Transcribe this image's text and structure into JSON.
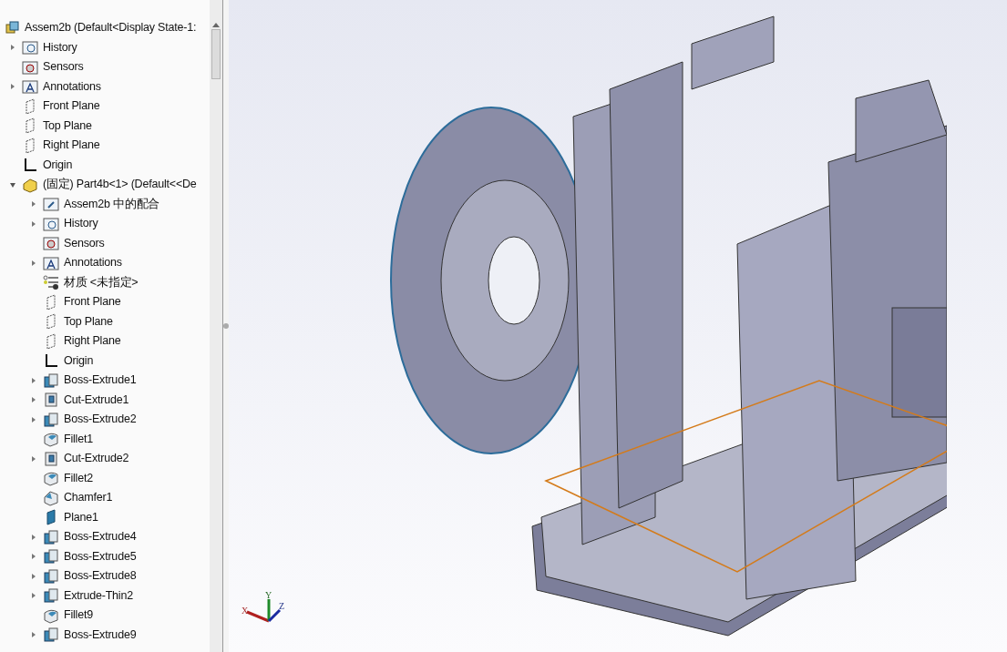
{
  "feature_tree": {
    "root": {
      "label": "Assem2b  (Default<Display State-1:",
      "kind": "assembly",
      "children": [
        {
          "label": "History",
          "kind": "history",
          "expandable": true,
          "expanded": false
        },
        {
          "label": "Sensors",
          "kind": "sensors",
          "expandable": false
        },
        {
          "label": "Annotations",
          "kind": "annotations",
          "expandable": true,
          "expanded": false
        },
        {
          "label": "Front Plane",
          "kind": "plane",
          "expandable": false
        },
        {
          "label": "Top Plane",
          "kind": "plane",
          "expandable": false
        },
        {
          "label": "Right Plane",
          "kind": "plane",
          "expandable": false
        },
        {
          "label": "Origin",
          "kind": "origin",
          "expandable": false
        },
        {
          "label": "(固定) Part4b<1> (Default<<De",
          "kind": "part",
          "expandable": true,
          "expanded": true,
          "children": [
            {
              "label": "Assem2b 中的配合",
              "kind": "mates",
              "expandable": true,
              "expanded": false
            },
            {
              "label": "History",
              "kind": "history",
              "expandable": true,
              "expanded": false
            },
            {
              "label": "Sensors",
              "kind": "sensors",
              "expandable": false
            },
            {
              "label": "Annotations",
              "kind": "annotations",
              "expandable": true,
              "expanded": false
            },
            {
              "label": "材质 <未指定>",
              "kind": "material",
              "expandable": false
            },
            {
              "label": "Front Plane",
              "kind": "plane",
              "expandable": false
            },
            {
              "label": "Top Plane",
              "kind": "plane",
              "expandable": false
            },
            {
              "label": "Right Plane",
              "kind": "plane",
              "expandable": false
            },
            {
              "label": "Origin",
              "kind": "origin",
              "expandable": false
            },
            {
              "label": "Boss-Extrude1",
              "kind": "boss",
              "expandable": true,
              "expanded": false
            },
            {
              "label": "Cut-Extrude1",
              "kind": "cut",
              "expandable": true,
              "expanded": false
            },
            {
              "label": "Boss-Extrude2",
              "kind": "boss",
              "expandable": true,
              "expanded": false
            },
            {
              "label": "Fillet1",
              "kind": "fillet",
              "expandable": false
            },
            {
              "label": "Cut-Extrude2",
              "kind": "cut",
              "expandable": true,
              "expanded": false
            },
            {
              "label": "Fillet2",
              "kind": "fillet",
              "expandable": false
            },
            {
              "label": "Chamfer1",
              "kind": "chamfer",
              "expandable": false
            },
            {
              "label": "Plane1",
              "kind": "refplane",
              "expandable": false
            },
            {
              "label": "Boss-Extrude4",
              "kind": "boss",
              "expandable": true,
              "expanded": false
            },
            {
              "label": "Boss-Extrude5",
              "kind": "boss",
              "expandable": true,
              "expanded": false
            },
            {
              "label": "Boss-Extrude8",
              "kind": "boss",
              "expandable": true,
              "expanded": false
            },
            {
              "label": "Extrude-Thin2",
              "kind": "boss",
              "expandable": true,
              "expanded": false
            },
            {
              "label": "Fillet9",
              "kind": "fillet",
              "expandable": false
            },
            {
              "label": "Boss-Extrude9",
              "kind": "boss",
              "expandable": true,
              "expanded": false
            }
          ]
        }
      ]
    }
  },
  "triad": {
    "x": "X",
    "y": "Y",
    "z": "Z"
  }
}
